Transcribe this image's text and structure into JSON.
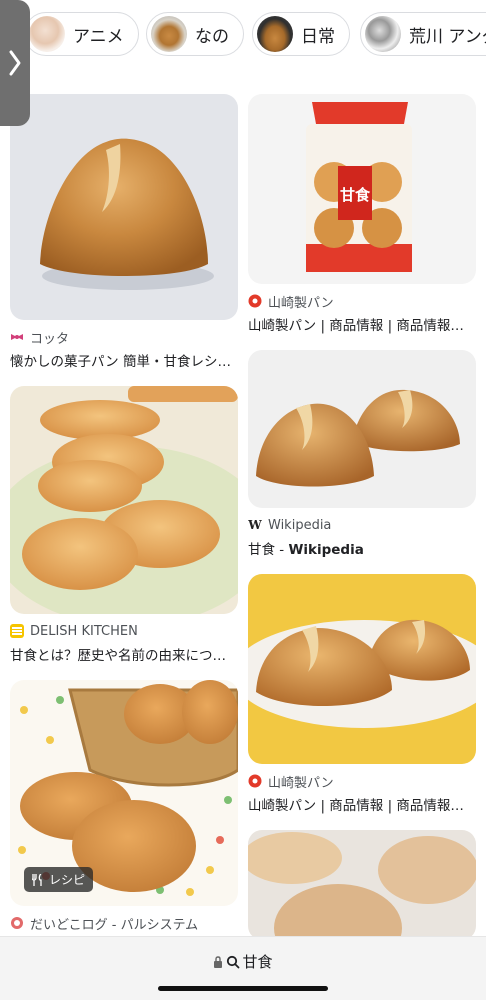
{
  "chips": [
    {
      "label": "アニメ",
      "thumb": "anime-thumbnail"
    },
    {
      "label": "なの",
      "thumb": "food-thumbnail"
    },
    {
      "label": "日常",
      "thumb": "bun-thumbnail"
    },
    {
      "label": "荒川 アンダ",
      "thumb": "manga-thumbnail"
    }
  ],
  "results": [
    {
      "source": "コッタ",
      "title": "懐かしの菓子パン 簡単・甘食レシ…",
      "favicon": "ribbon-icon"
    },
    {
      "source": "山崎製パン",
      "title": "山崎製パン | 商品情報 | 商品情報…",
      "favicon": "yamazaki-icon"
    },
    {
      "source": "Wikipedia",
      "title_main": "甘食 - ",
      "title_bold": "Wikipedia",
      "favicon": "wikipedia-icon"
    },
    {
      "source": "DELISH KITCHEN",
      "title": "甘食とは？歴史や名前の由来につ…",
      "favicon": "delish-kitchen-icon"
    },
    {
      "source": "山崎製パン",
      "title": "山崎製パン | 商品情報 | 商品情報…",
      "favicon": "yamazaki-icon"
    },
    {
      "source": "だいどこログ - パルシステム",
      "title": "",
      "favicon": "daidokolog-icon",
      "badge": "レシピ"
    },
    {
      "package_text": "甘食"
    }
  ],
  "address_bar": {
    "query": "甘食"
  },
  "colors": {
    "accent_red": "#d0261d",
    "bun_brown": "#c98a43"
  }
}
